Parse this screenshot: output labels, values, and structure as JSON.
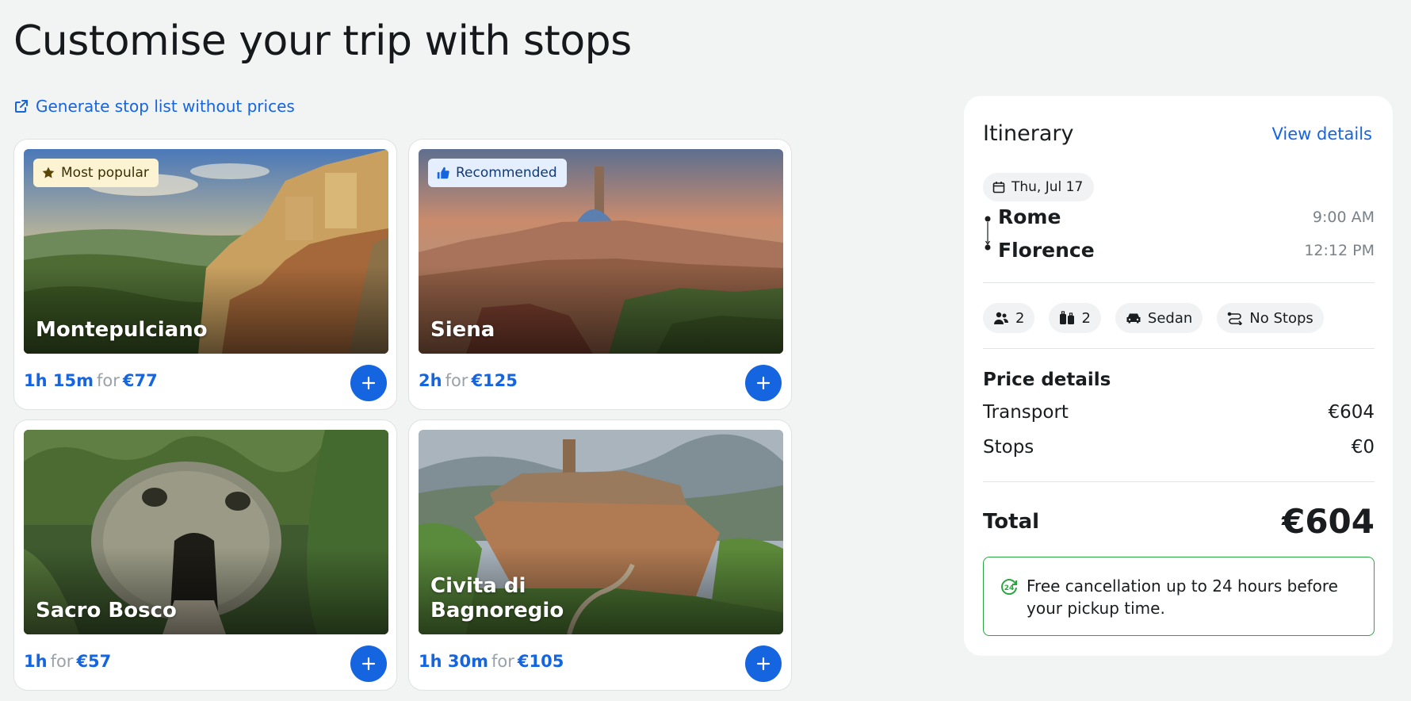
{
  "page": {
    "title": "Customise your trip with stops",
    "generate_link": "Generate stop list without prices"
  },
  "stops": [
    {
      "badge": "Most popular",
      "badge_icon": "star-icon",
      "name": "Montepulciano",
      "duration": "1h 15m",
      "for": "for",
      "price": "€77"
    },
    {
      "badge": "Recommended",
      "badge_icon": "thumbs-up-icon",
      "name": "Siena",
      "duration": "2h",
      "for": "for",
      "price": "€125"
    },
    {
      "badge": "",
      "name": "Sacro Bosco",
      "duration": "1h",
      "for": "for",
      "price": "€57"
    },
    {
      "badge": "",
      "name": "Civita di Bagnoregio",
      "duration": "1h 30m",
      "for": "for",
      "price": "€105"
    }
  ],
  "itinerary": {
    "title": "Itinerary",
    "view_details": "View details",
    "date": "Thu, Jul 17",
    "origin": {
      "name": "Rome",
      "time": "9:00 AM"
    },
    "destination": {
      "name": "Florence",
      "time": "12:12 PM"
    },
    "passengers": "2",
    "luggage": "2",
    "vehicle": "Sedan",
    "stops_label": "No Stops",
    "price_details_title": "Price details",
    "transport_label": "Transport",
    "transport_value": "€604",
    "stops_price_label": "Stops",
    "stops_price_value": "€0",
    "total_label": "Total",
    "total_value": "€604",
    "cancellation": "Free cancellation up to 24 hours before your pickup time."
  },
  "colors": {
    "accent": "#1565e0",
    "background": "#f2f3f3",
    "success": "#2aa640"
  }
}
